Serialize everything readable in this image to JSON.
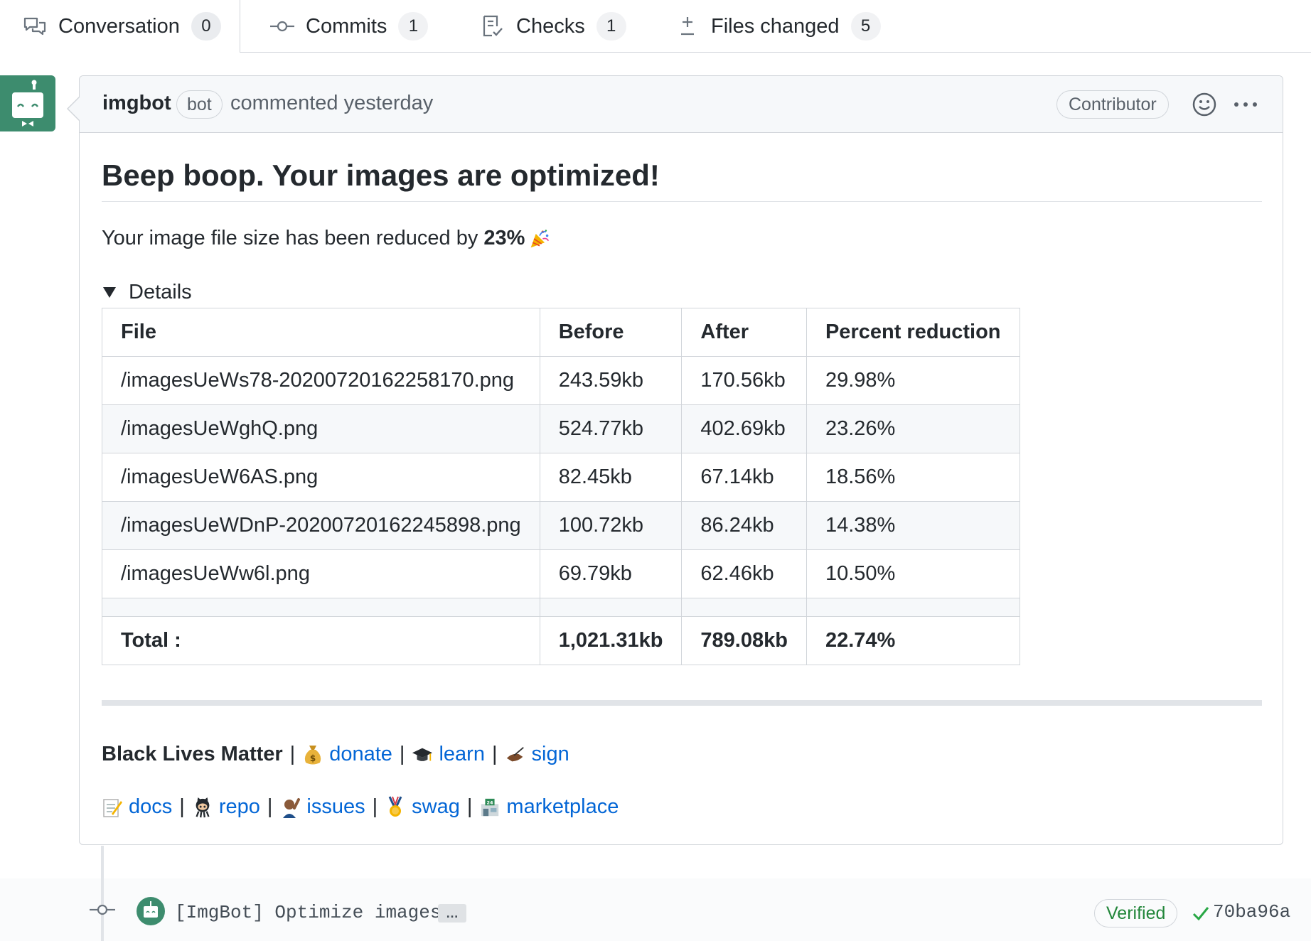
{
  "tabs": [
    {
      "label": "Conversation",
      "count": "0",
      "icon": "conversation-icon"
    },
    {
      "label": "Commits",
      "count": "1",
      "icon": "commit-icon"
    },
    {
      "label": "Checks",
      "count": "1",
      "icon": "checklist-icon"
    },
    {
      "label": "Files changed",
      "count": "5",
      "icon": "diff-icon"
    }
  ],
  "comment": {
    "author": "imgbot",
    "author_badge": "bot",
    "meta": "commented yesterday",
    "role": "Contributor",
    "title": "Beep boop. Your images are optimized!",
    "summary_prefix": "Your image file size has been reduced by",
    "summary_value": "23%",
    "details_label": "Details"
  },
  "table": {
    "headers": [
      "File",
      "Before",
      "After",
      "Percent reduction"
    ],
    "rows": [
      [
        "/imagesUeWs78-20200720162258170.png",
        "243.59kb",
        "170.56kb",
        "29.98%"
      ],
      [
        "/imagesUeWghQ.png",
        "524.77kb",
        "402.69kb",
        "23.26%"
      ],
      [
        "/imagesUeW6AS.png",
        "82.45kb",
        "67.14kb",
        "18.56%"
      ],
      [
        "/imagesUeWDnP-20200720162245898.png",
        "100.72kb",
        "86.24kb",
        "14.38%"
      ],
      [
        "/imagesUeWw6l.png",
        "69.79kb",
        "62.46kb",
        "10.50%"
      ]
    ],
    "total": [
      "Total :",
      "1,021.31kb",
      "789.08kb",
      "22.74%"
    ]
  },
  "footer": {
    "blm": "Black Lives Matter",
    "sep": "|",
    "line1_links": [
      "donate",
      "learn",
      "sign"
    ],
    "line2_links": [
      "docs",
      "repo",
      "issues",
      "swag",
      "marketplace"
    ]
  },
  "commit": {
    "message": "[ImgBot] Optimize images",
    "expand": "…",
    "verified": "Verified",
    "sha": "70ba96a"
  },
  "colors": {
    "link": "#0366d6",
    "verified": "#22863a",
    "avatar": "#3d8c6e"
  }
}
